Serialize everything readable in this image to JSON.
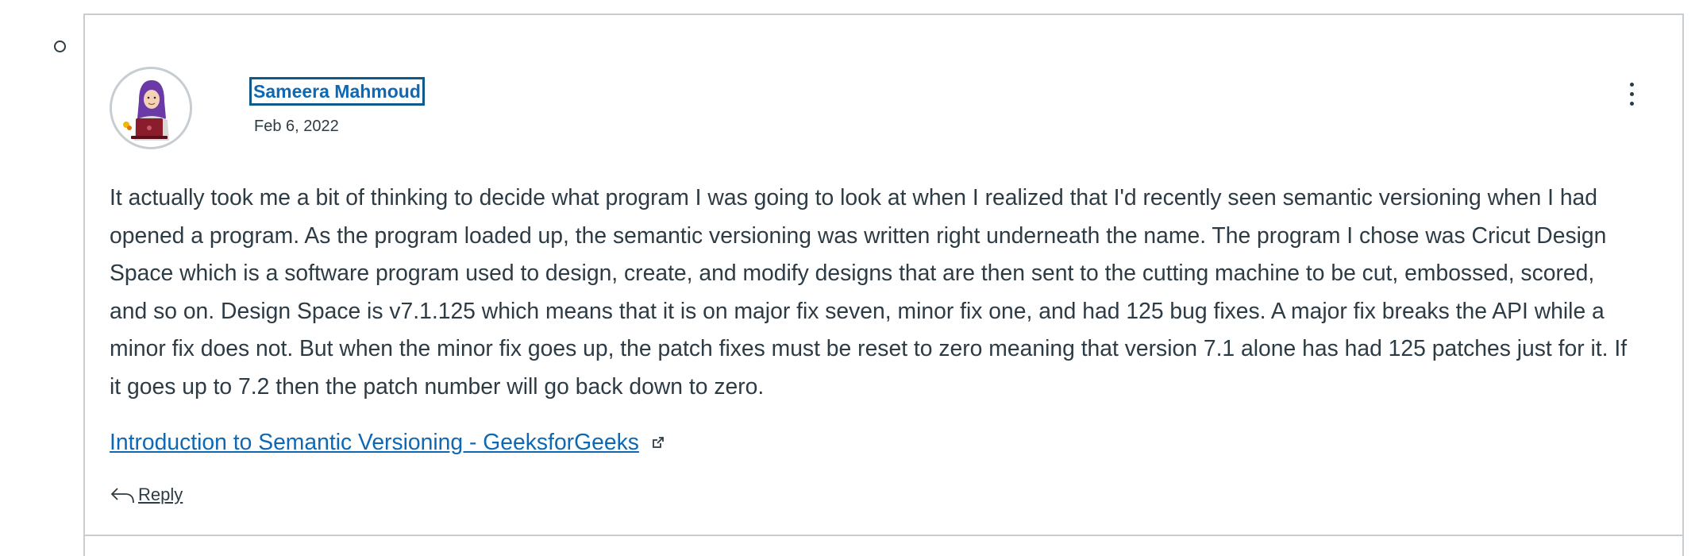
{
  "entry": {
    "author_name": "Sameera Mahmoud",
    "date": "Feb 6, 2022",
    "body": "It actually took me a bit of thinking to decide what program I was going to look at when I realized that I'd recently seen semantic versioning when I had opened a program. As the program loaded up, the semantic versioning was written right underneath the name. The program I chose was Cricut Design Space which is a software program used to design, create, and modify designs that are then sent to the cutting machine to be cut, embossed, scored, and so on. Design Space is v7.1.125 which means that it is on major fix seven, minor fix one, and had 125 bug fixes. A major fix breaks the API while a minor fix does not. But when the minor fix goes up, the patch fixes must be reset to zero meaning that version 7.1 alone has had 125 patches just for it. If it goes up to 7.2 then the patch number will go back down to zero.",
    "link_text": "Introduction to Semantic Versioning - GeeksforGeeks",
    "reply_label": "Reply"
  },
  "icons": {
    "avatar": "avatar-illustration",
    "options": "kebab-menu-icon",
    "external_link": "external-link-icon",
    "reply": "reply-arrow-icon",
    "bullet": "list-bullet-icon"
  },
  "colors": {
    "text": "#2d3b45",
    "link": "#0e68b3",
    "border": "#c7cdd1",
    "focus_outline": "#0e5a8a"
  }
}
